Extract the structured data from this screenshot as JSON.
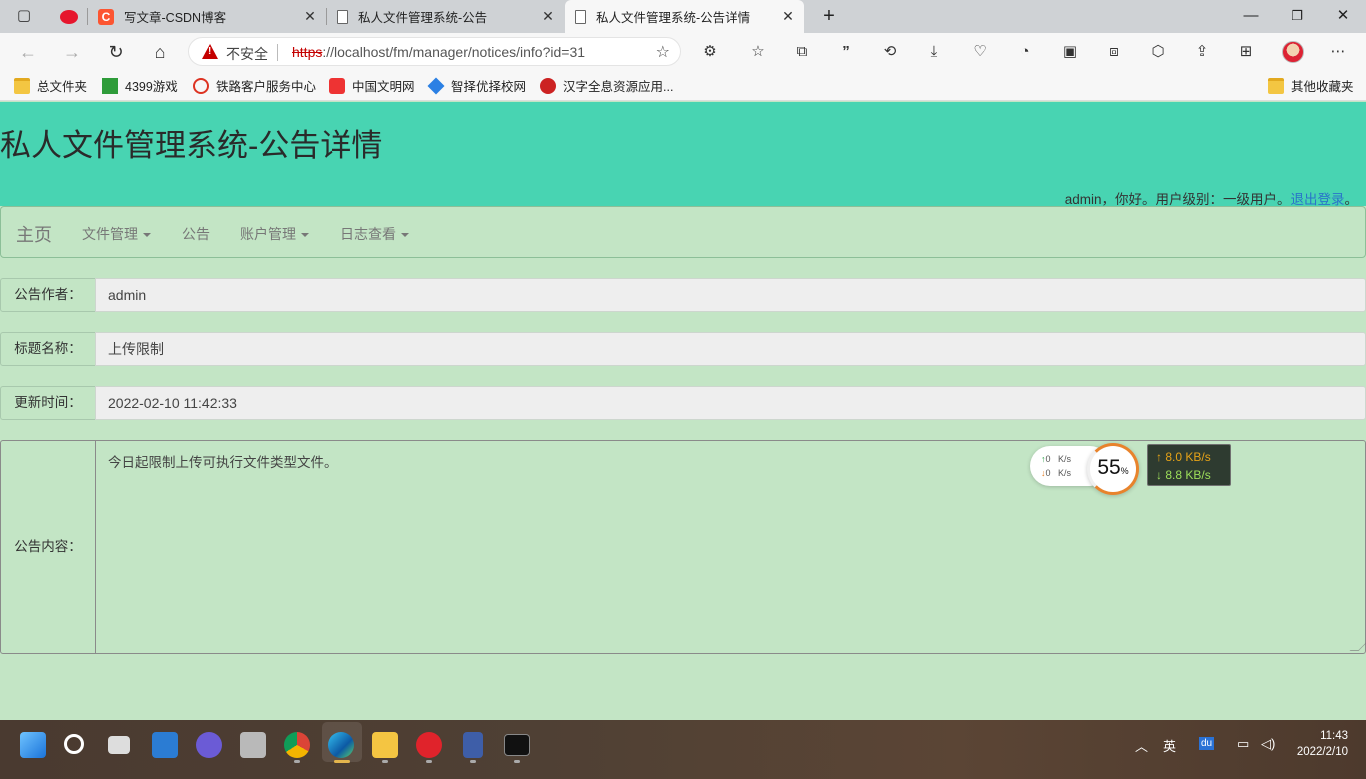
{
  "browser": {
    "tabs": [
      {
        "title": "",
        "icon": "weibo-icon"
      },
      {
        "title": "写文章-CSDN博客",
        "icon": "csdn-icon"
      },
      {
        "title": "私人文件管理系统-公告",
        "icon": "page-icon"
      },
      {
        "title": "私人文件管理系统-公告详情",
        "icon": "page-icon",
        "active": true
      }
    ],
    "new_tab_symbol": "+",
    "window_controls": {
      "minimize": "—",
      "maximize": "❐",
      "close": "✕"
    },
    "security_label": "不安全",
    "url_scheme": "https",
    "url_rest": "://localhost/fm/manager/notices/info?id=31",
    "bookmarks": [
      {
        "label": "总文件夹",
        "icon": "folder-icon"
      },
      {
        "label": "4399游戏",
        "icon": "game-icon"
      },
      {
        "label": "铁路客户服务中心",
        "icon": "railway-icon"
      },
      {
        "label": "中国文明网",
        "icon": "civilization-icon"
      },
      {
        "label": "智择优择校网",
        "icon": "gem-icon"
      },
      {
        "label": "汉字全息资源应用...",
        "icon": "hanzi-icon"
      }
    ],
    "other_bookmarks": "其他收藏夹"
  },
  "site": {
    "title": "私人文件管理系统-公告详情",
    "greeting_prefix": "admin，你好。用户级别：一级用户。",
    "logout_label": "退出登录",
    "greeting_suffix": "。"
  },
  "nav": {
    "brand": "主页",
    "items": [
      {
        "label": "文件管理",
        "dropdown": true
      },
      {
        "label": "公告",
        "dropdown": false
      },
      {
        "label": "账户管理",
        "dropdown": true
      },
      {
        "label": "日志查看",
        "dropdown": true
      }
    ]
  },
  "notice": {
    "author_label": "公告作者：",
    "author_value": "admin",
    "title_label": "标题名称：",
    "title_value": "上传限制",
    "updated_label": "更新时间：",
    "updated_value": "2022-02-10 11:42:33",
    "content_label": "公告内容：",
    "content_value": "今日起限制上传可执行文件类型文件。"
  },
  "net_widget": {
    "up_small": "0",
    "down_small": "0",
    "unit_small": "K/s",
    "percent": "55",
    "percent_sign": "%",
    "upload": "8.0 KB/s",
    "download": "8.8 KB/s"
  },
  "taskbar": {
    "ime": "英",
    "baidu": "du",
    "time": "11:43",
    "date": "2022/2/10"
  },
  "colors": {
    "header": "#48d4b2",
    "page_bg": "#c3e5c5",
    "input_bg": "#eeeeee",
    "link": "#2a75c9",
    "insecure_red": "#c40000"
  }
}
